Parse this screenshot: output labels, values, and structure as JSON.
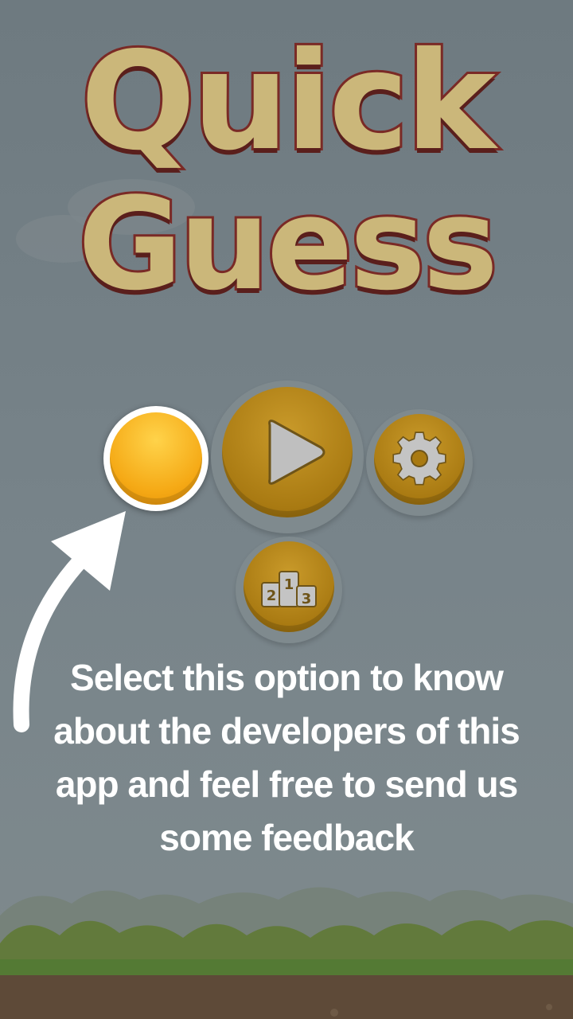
{
  "game": {
    "title_line1": "Quick",
    "title_line2": "Guess"
  },
  "menu": {
    "info_icon": "info-icon",
    "play_icon": "play-icon",
    "settings_icon": "gear-icon",
    "leaderboard_icon": "podium-icon",
    "podium_numbers": [
      "2",
      "1",
      "3"
    ]
  },
  "tutorial": {
    "hint_text": "Select this option to know about the developers of this app and feel free to send us some feedback",
    "pointer": "curved-arrow-icon"
  },
  "colors": {
    "accent": "#f5a915",
    "title_fill": "#cbb77a",
    "title_outline": "#7a2a26",
    "button_dim": "#a97a12",
    "overlay": "#6e7a80"
  }
}
